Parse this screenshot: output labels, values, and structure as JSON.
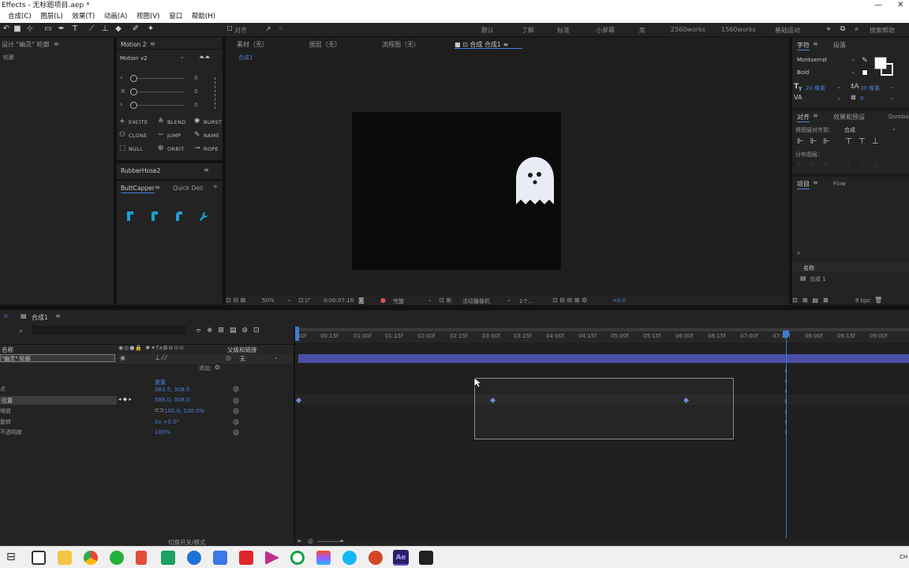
{
  "titlebar": {
    "title": "Effects - 无标题项目.aep *",
    "minimize": "—",
    "close": "✕"
  },
  "menubar": {
    "items": [
      "合成(C)",
      "图层(L)",
      "效果(T)",
      "动画(A)",
      "视图(V)",
      "窗口",
      "帮助(H)"
    ]
  },
  "toolbar": {
    "snap_label": "对齐",
    "workspaces": [
      "默认",
      "了解",
      "标准",
      "小屏幕",
      "库",
      "2560works",
      "1560works",
      "基础运动"
    ],
    "search_help": "搜索帮助"
  },
  "left_panel": {
    "tab_label": "设计 \"幽灵\" 轮廓",
    "tab_sub": "轮廓"
  },
  "motion": {
    "tab_label": "Motion 2",
    "version": "Motion v2",
    "sliders": [
      {
        "arrow": "‹",
        "value": "0"
      },
      {
        "arrow": "×",
        "value": "0"
      },
      {
        "arrow": "›",
        "value": "0"
      }
    ],
    "buttons": [
      {
        "icon": "+",
        "label": "EXCITE"
      },
      {
        "icon": "≗",
        "label": "BLEND"
      },
      {
        "icon": "✺",
        "label": "BURST"
      },
      {
        "icon": "⚇",
        "label": "CLONE"
      },
      {
        "icon": "∼",
        "label": "JUMP"
      },
      {
        "icon": "✎",
        "label": "NAME"
      },
      {
        "icon": "⬚",
        "label": "NULL"
      },
      {
        "icon": "⊛",
        "label": "ORBIT"
      },
      {
        "icon": "⊸",
        "label": "ROPE"
      }
    ]
  },
  "rubberhose": {
    "tab_label": "RubberHose2"
  },
  "buttcapper": {
    "tab_label": "ButtCapper",
    "tab2_label": "Quick Deli",
    "more": "»"
  },
  "viewer_tabs": {
    "footage": "素材（无）",
    "layer": "图层（无）",
    "flowchart": "流程图（无）",
    "composition": "合成 合成1",
    "breadcrumb": "合成1"
  },
  "viewer_footer": {
    "zoom": "50%",
    "timecode": "0:00:07:16",
    "quality": "完整",
    "camera": "活动摄像机",
    "views": "1个...",
    "exposure": "+0.0"
  },
  "character": {
    "tab_label": "字符",
    "tab2_label": "段落",
    "font": "Montserrat",
    "style": "Bold",
    "size": "20 像素",
    "leading": "30 像素",
    "tracking": "0"
  },
  "align": {
    "tab_label": "对齐",
    "tab2_label": "效果和预设",
    "tab3_label": "Duroba",
    "align_to_label": "将图层对齐到：",
    "align_to_value": "合成",
    "distribute_label": "分布图层："
  },
  "project": {
    "tab_label": "项目",
    "tab2_label": "Flow",
    "column_name": "名称",
    "items": [
      "合成 1"
    ],
    "bpc": "8 bpc"
  },
  "timeline": {
    "tab_label": "合成1",
    "col_name": "名称",
    "col_parent": "父级和链接",
    "layer_name": "\"幽灵\" 轮廓",
    "parent_value": "无",
    "add_label": "添加:",
    "props": [
      {
        "name": "点",
        "value": "重置"
      },
      {
        "name": "位置",
        "value": "383.5, 308.5"
      },
      {
        "name": "缩放",
        "value": "588.0, 308.0"
      },
      {
        "name": "旋转",
        "value": "100.0, 100.0%"
      },
      {
        "name": "不透明度",
        "value": "0x +0.0°"
      },
      {
        "name": "",
        "value": "100%"
      }
    ],
    "ruler": [
      "00f",
      "00:15f",
      "01:00f",
      "01:15f",
      "02:00f",
      "02:15f",
      "03:00f",
      "03:15f",
      "04:00f",
      "04:15f",
      "05:00f",
      "05:15f",
      "06:00f",
      "06:15f",
      "07:00f",
      "07:15f",
      "08:00f",
      "08:15f",
      "09:00f"
    ],
    "switch_mode": "切换开关/模式"
  },
  "colors": {
    "accent": "#4a7fd8",
    "layer_bar": "#4a4fa8",
    "playhead": "#3f7bd6",
    "ghost": "#e8eaf4"
  },
  "taskbar": {
    "icons": [
      "task-view-icon",
      "calendar-icon",
      "folder-icon",
      "chrome-icon",
      "wechat-icon",
      "pen-tool-icon",
      "app-green-icon",
      "edge-icon",
      "app-blue-icon",
      "app-red-icon",
      "app-arrow-icon",
      "app-circle-green-icon",
      "figma-icon",
      "qq-icon",
      "powerpoint-icon",
      "after-effects-icon",
      "photos-icon"
    ],
    "ime": "CH"
  }
}
